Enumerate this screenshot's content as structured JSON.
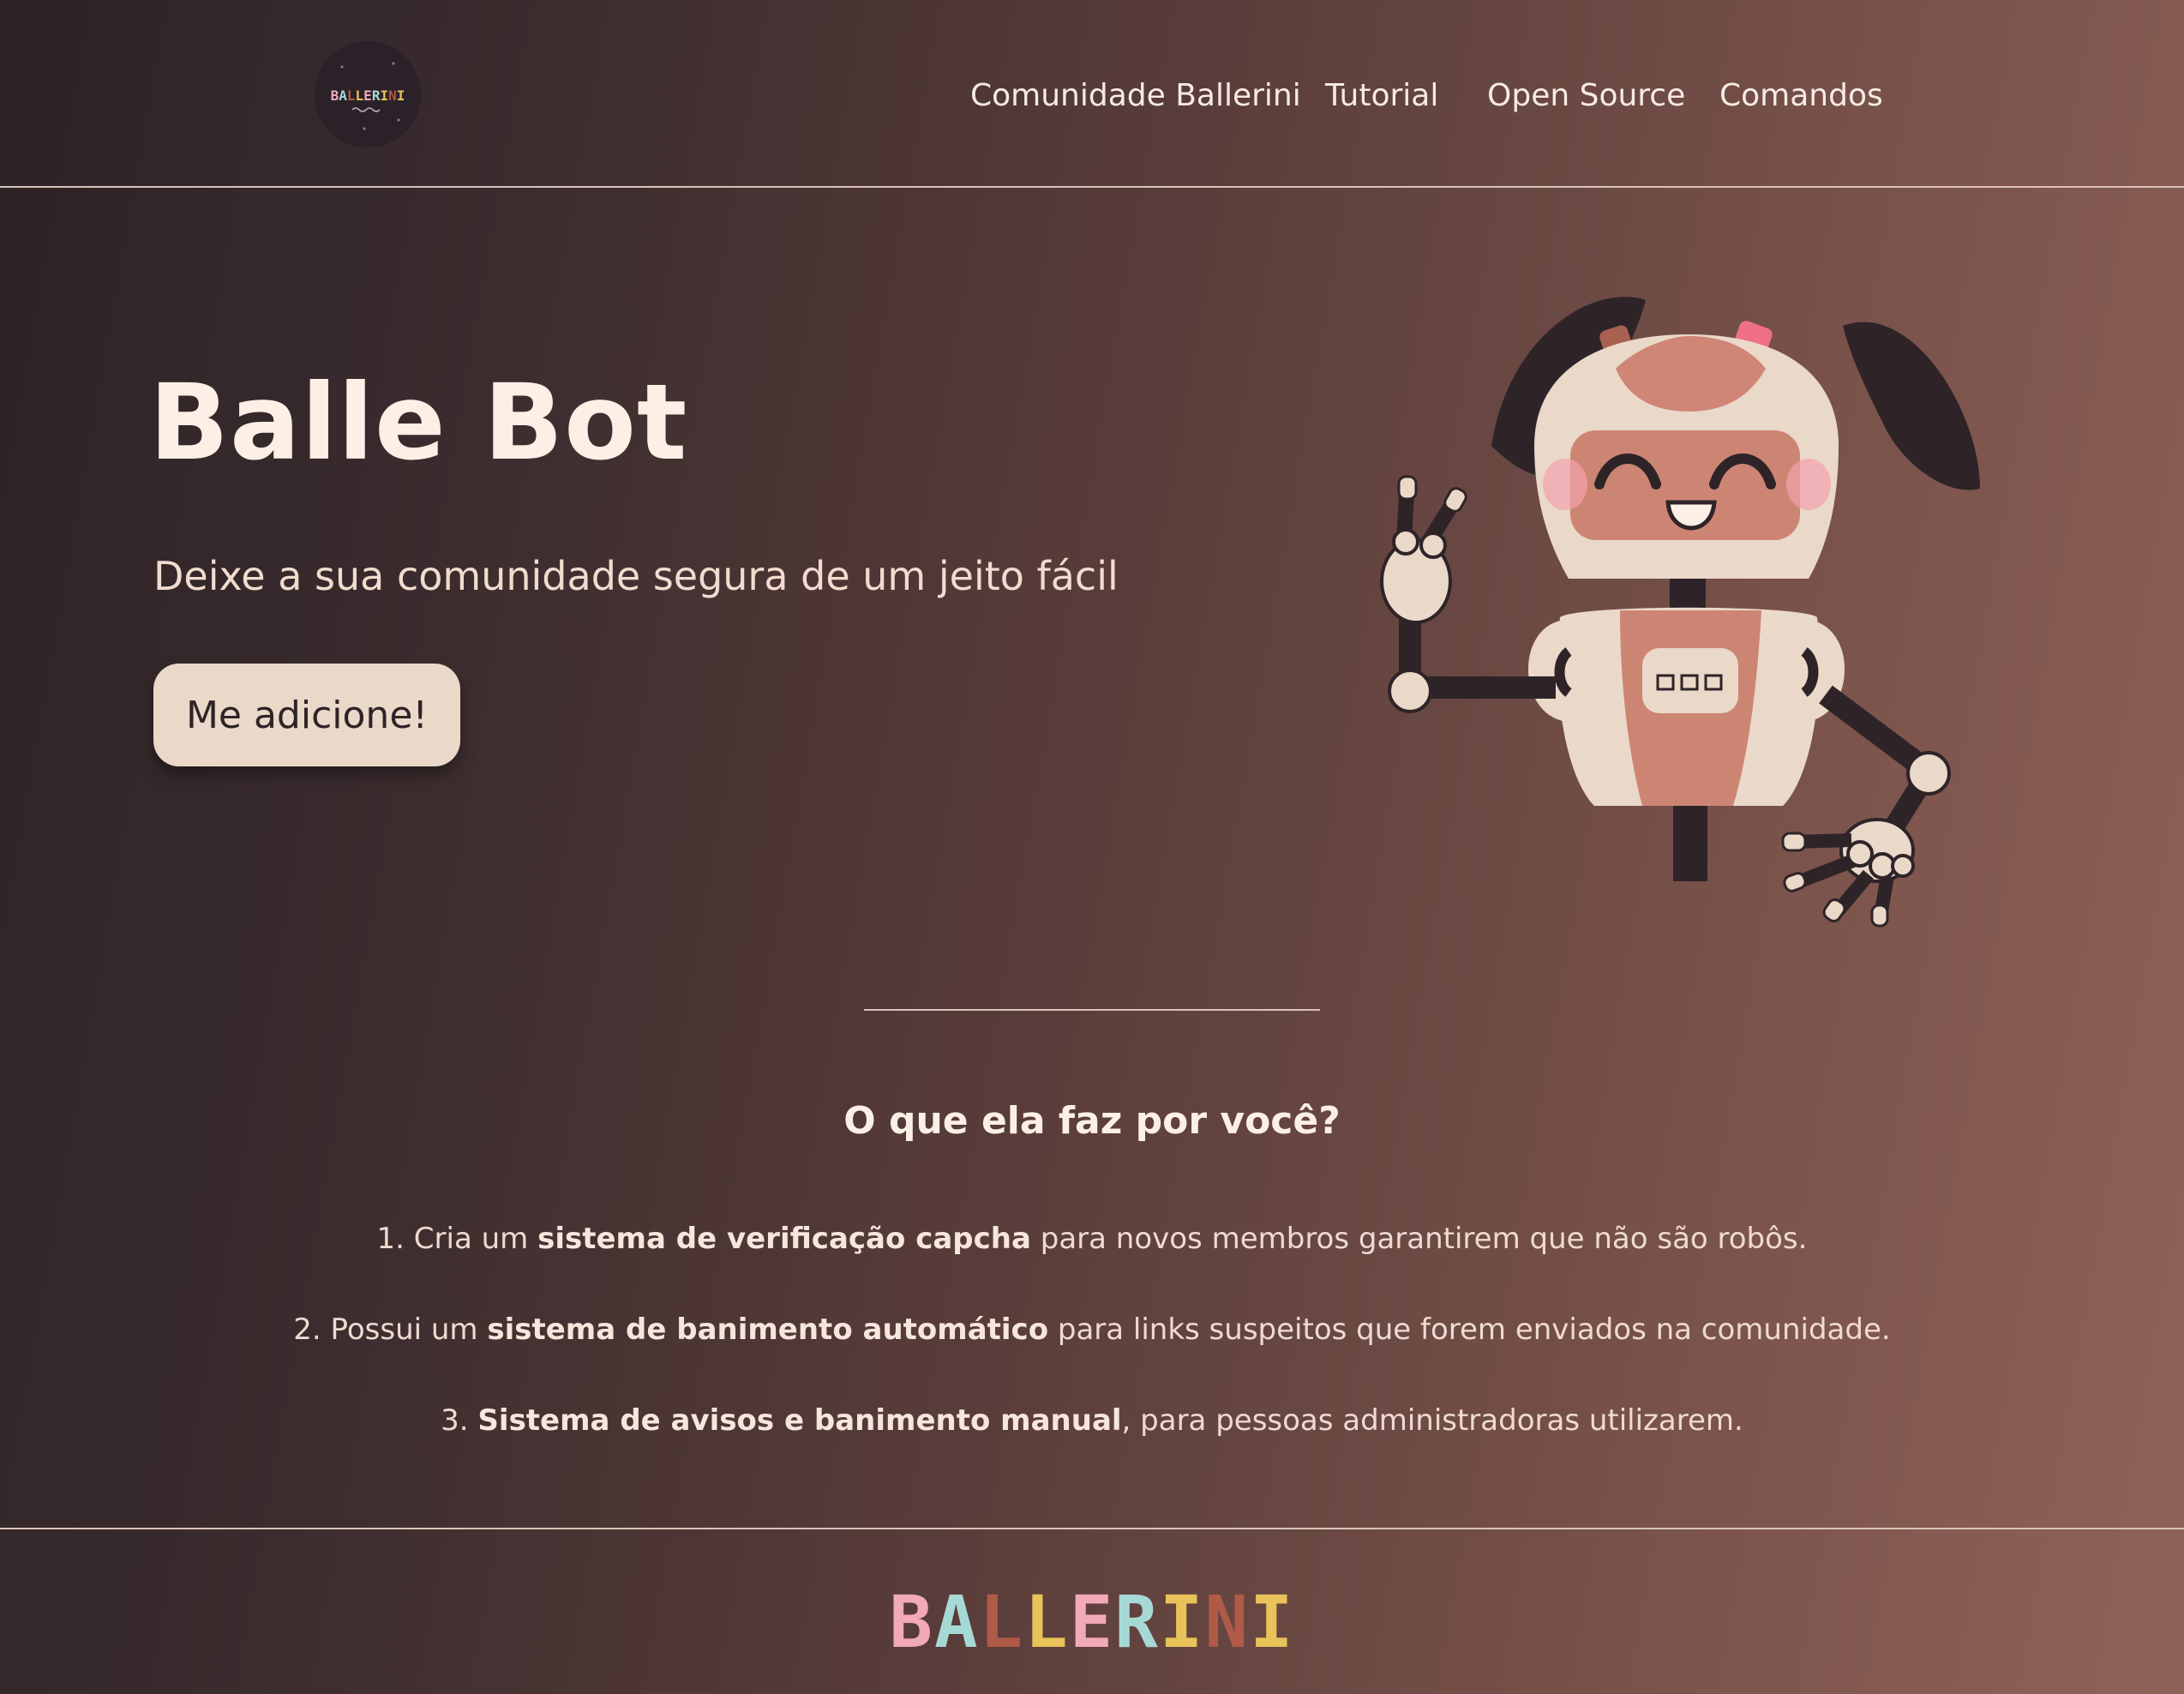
{
  "header": {
    "logo_text": "BALLERINI",
    "nav": [
      {
        "label": "Comunidade Ballerini"
      },
      {
        "label": "Tutorial"
      },
      {
        "label": "Open Source"
      },
      {
        "label": "Comandos"
      }
    ]
  },
  "hero": {
    "title": "Balle Bot",
    "subtitle": "Deixe a sua comunidade segura de um jeito fácil",
    "cta_label": "Me adicione!"
  },
  "features": {
    "title": "O que ela faz por você?",
    "items": [
      {
        "prefix": "1. Cria um ",
        "bold": "sistema de verificação capcha",
        "suffix": " para novos membros garantirem que não são robôs."
      },
      {
        "prefix": "2. Possui um ",
        "bold": "sistema de banimento automático",
        "suffix": " para links suspeitos que forem enviados na comunidade."
      },
      {
        "prefix": "3. ",
        "bold": "Sistema de avisos e banimento manual",
        "suffix": ", para pessoas administradoras utilizarem."
      }
    ]
  },
  "footer": {
    "letters": [
      "B",
      "A",
      "L",
      "L",
      "E",
      "R",
      "I",
      "N",
      "I"
    ]
  },
  "colors": {
    "logo_letters": [
      "#f2a9b8",
      "#a6d9d6",
      "#b05a48",
      "#e8c35a",
      "#f2a9b8",
      "#a6d9d6",
      "#e8c35a",
      "#b05a48",
      "#e8c35a"
    ]
  },
  "icons": {
    "logo": "ballerini-badge-icon",
    "mascot": "robot-mascot-illustration"
  }
}
